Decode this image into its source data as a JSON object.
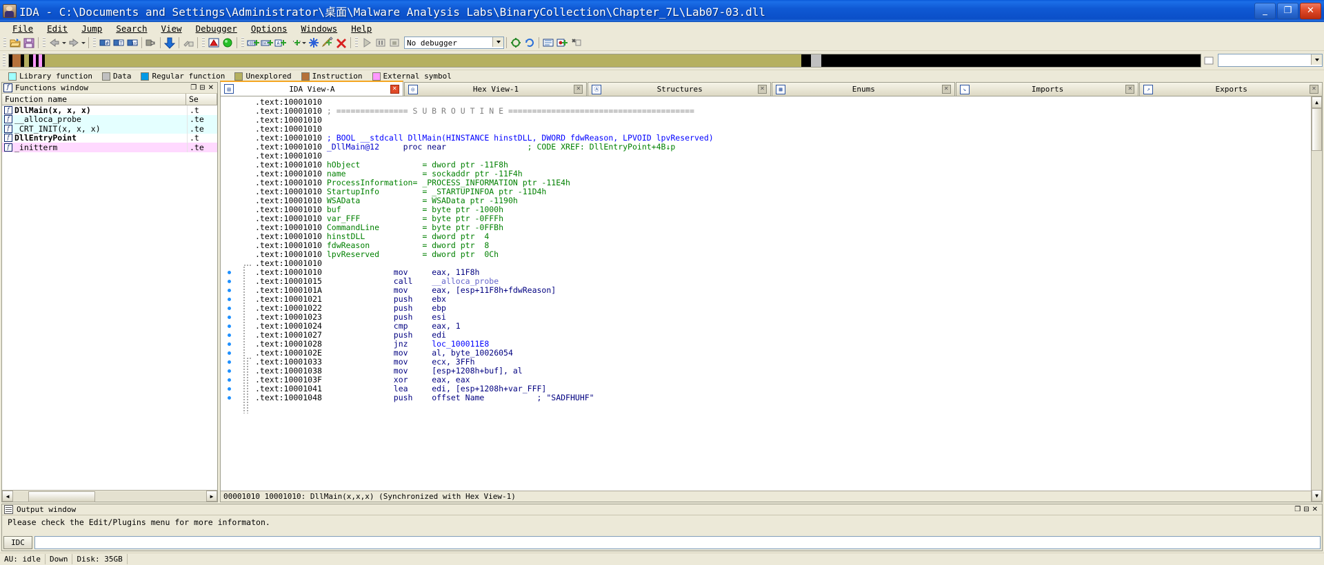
{
  "window": {
    "title": "IDA - C:\\Documents and Settings\\Administrator\\桌面\\Malware Analysis Labs\\BinaryCollection\\Chapter_7L\\Lab07-03.dll",
    "minimize_label": "—",
    "maximize_label": "❐",
    "close_label": "✕"
  },
  "menu": [
    {
      "label": "File"
    },
    {
      "label": "Edit"
    },
    {
      "label": "Jump"
    },
    {
      "label": "Search"
    },
    {
      "label": "View"
    },
    {
      "label": "Debugger"
    },
    {
      "label": "Options"
    },
    {
      "label": "Windows"
    },
    {
      "label": "Help"
    }
  ],
  "toolbar": {
    "debugger_value": "No debugger",
    "icons": [
      "open-file-icon",
      "save-icon",
      "back-arrow-icon",
      "forward-arrow-icon",
      "search-hex-icon",
      "search-text-icon",
      "search-binary-icon",
      "jump-icon",
      "down-arrow-icon",
      "unlock-icon",
      "warning-icon",
      "green-circle-icon",
      "make-code-icon",
      "make-data-icon",
      "make-ascii-icon",
      "make-struct-icon",
      "make-array-icon",
      "edit-function-icon",
      "delete-icon",
      "run-icon",
      "pause-icon",
      "stop-icon"
    ]
  },
  "navbar": {
    "segments": [
      {
        "name": "unexplored-left",
        "color": "#b5b060",
        "left_pct": 0.5,
        "width_pct": 0.6
      },
      {
        "name": "instruction-strip",
        "color": "#b5713a",
        "left_pct": 1.2,
        "width_pct": 0.35
      },
      {
        "name": "external-symbol",
        "color": "#ff99ff",
        "left_pct": 2.1,
        "width_pct": 0.25
      },
      {
        "name": "external-symbol-2",
        "color": "#ff99ff",
        "left_pct": 2.6,
        "width_pct": 0.2
      },
      {
        "name": "unexplored-main",
        "color": "#b5b060",
        "left_pct": 3.1,
        "width_pct": 63.5
      },
      {
        "name": "data-grey",
        "color": "#c0c0c0",
        "left_pct": 67.6,
        "width_pct": 0.9
      }
    ],
    "combo_value": ""
  },
  "legend": [
    {
      "label": "Library function",
      "color": "#9fffff"
    },
    {
      "label": "Data",
      "color": "#c0c0c0"
    },
    {
      "label": "Regular function",
      "color": "#0099e6"
    },
    {
      "label": "Unexplored",
      "color": "#b5b060"
    },
    {
      "label": "Instruction",
      "color": "#b5713a"
    },
    {
      "label": "External symbol",
      "color": "#ff99ff"
    }
  ],
  "functions_window": {
    "title": "Functions window",
    "icon": "function-f-icon",
    "buttons": [
      "maximize-icon",
      "restore-icon",
      "close-icon"
    ],
    "columns": [
      "Function name",
      "Se"
    ],
    "rows": [
      {
        "name": "DllMain(x, x, x)",
        "segment": ".t",
        "bg": "#ffffff",
        "bold": true
      },
      {
        "name": "__alloca_probe",
        "segment": ".te",
        "bg": "#e4ffff",
        "bold": false
      },
      {
        "name": "_CRT_INIT(x, x, x)",
        "segment": ".te",
        "bg": "#e4ffff",
        "bold": false
      },
      {
        "name": "DllEntryPoint",
        "segment": ".t",
        "bg": "#ffffff",
        "bold": true
      },
      {
        "name": "_initterm",
        "segment": ".te",
        "bg": "#ffd9ff",
        "bold": false
      }
    ]
  },
  "tabs": [
    {
      "label": "IDA View-A",
      "icon": "disasm-view-icon",
      "active": true
    },
    {
      "label": "Hex View-1",
      "icon": "hex-view-icon",
      "active": false
    },
    {
      "label": "Structures",
      "icon": "structures-icon",
      "active": false
    },
    {
      "label": "Enums",
      "icon": "enums-icon",
      "active": false
    },
    {
      "label": "Imports",
      "icon": "imports-icon",
      "active": false
    },
    {
      "label": "Exports",
      "icon": "exports-icon",
      "active": false
    }
  ],
  "disassembly": {
    "lines": [
      {
        "addr": ".text:10001010",
        "text": "",
        "kind": "plain",
        "bp": false
      },
      {
        "addr": ".text:10001010",
        "text": "; =============== S U B R O U T I N E =======================================",
        "kind": "comment",
        "bp": false
      },
      {
        "addr": ".text:10001010",
        "text": "",
        "kind": "plain",
        "bp": false
      },
      {
        "addr": ".text:10001010",
        "text": "",
        "kind": "plain",
        "bp": false
      },
      {
        "addr": ".text:10001010",
        "text": "; BOOL __stdcall DllMain(HINSTANCE hinstDLL, DWORD fdwReason, LPVOID lpvReserved)",
        "kind": "decl",
        "bp": false
      },
      {
        "addr": ".text:10001010",
        "name": "_DllMain@12",
        "mnemonic": "proc near",
        "xref": "; CODE XREF: DllEntryPoint+4B↓p",
        "kind": "proc",
        "bp": false
      },
      {
        "addr": ".text:10001010",
        "text": "",
        "kind": "plain",
        "bp": false
      },
      {
        "addr": ".text:10001010",
        "var": "hObject",
        "def": "= dword ptr -11F8h",
        "kind": "var",
        "bp": false
      },
      {
        "addr": ".text:10001010",
        "var": "name",
        "def": "= sockaddr ptr -11F4h",
        "kind": "var",
        "bp": false
      },
      {
        "addr": ".text:10001010",
        "var": "ProcessInformation=",
        "def": "_PROCESS_INFORMATION ptr -11E4h",
        "kind": "var2",
        "bp": false
      },
      {
        "addr": ".text:10001010",
        "var": "StartupInfo",
        "def": "= _STARTUPINFOA ptr -11D4h",
        "kind": "var",
        "bp": false
      },
      {
        "addr": ".text:10001010",
        "var": "WSAData",
        "def": "= WSAData ptr -1190h",
        "kind": "var",
        "bp": false
      },
      {
        "addr": ".text:10001010",
        "var": "buf",
        "def": "= byte ptr -1000h",
        "kind": "var",
        "bp": false
      },
      {
        "addr": ".text:10001010",
        "var": "var_FFF",
        "def": "= byte ptr -0FFFh",
        "kind": "var",
        "bp": false
      },
      {
        "addr": ".text:10001010",
        "var": "CommandLine",
        "def": "= byte ptr -0FFBh",
        "kind": "var",
        "bp": false
      },
      {
        "addr": ".text:10001010",
        "var": "hinstDLL",
        "def": "= dword ptr  4",
        "kind": "var",
        "bp": false
      },
      {
        "addr": ".text:10001010",
        "var": "fdwReason",
        "def": "= dword ptr  8",
        "kind": "var",
        "bp": false
      },
      {
        "addr": ".text:10001010",
        "var": "lpvReserved",
        "def": "= dword ptr  0Ch",
        "kind": "var",
        "bp": false
      },
      {
        "addr": ".text:10001010",
        "text": "",
        "kind": "plain",
        "bp": false
      },
      {
        "addr": ".text:10001010",
        "mnemonic": "mov",
        "operands": "eax, 11F8h",
        "kind": "insn",
        "bp": true
      },
      {
        "addr": ".text:10001015",
        "mnemonic": "call",
        "operands": "__alloca_probe",
        "kind": "call",
        "bp": true
      },
      {
        "addr": ".text:1000101A",
        "mnemonic": "mov",
        "operands": "eax, [esp+11F8h+fdwReason]",
        "kind": "insn",
        "bp": true
      },
      {
        "addr": ".text:10001021",
        "mnemonic": "push",
        "operands": "ebx",
        "kind": "insn",
        "bp": true
      },
      {
        "addr": ".text:10001022",
        "mnemonic": "push",
        "operands": "ebp",
        "kind": "insn",
        "bp": true
      },
      {
        "addr": ".text:10001023",
        "mnemonic": "push",
        "operands": "esi",
        "kind": "insn",
        "bp": true
      },
      {
        "addr": ".text:10001024",
        "mnemonic": "cmp",
        "operands": "eax, 1",
        "kind": "insn",
        "bp": true
      },
      {
        "addr": ".text:10001027",
        "mnemonic": "push",
        "operands": "edi",
        "kind": "insn",
        "bp": true
      },
      {
        "addr": ".text:10001028",
        "mnemonic": "jnz",
        "operands": "loc_100011E8",
        "kind": "jump",
        "bp": true
      },
      {
        "addr": ".text:1000102E",
        "mnemonic": "mov",
        "operands": "al, byte_10026054",
        "kind": "insn",
        "bp": true
      },
      {
        "addr": ".text:10001033",
        "mnemonic": "mov",
        "operands": "ecx, 3FFh",
        "kind": "insn",
        "bp": true
      },
      {
        "addr": ".text:10001038",
        "mnemonic": "mov",
        "operands": "[esp+1208h+buf], al",
        "kind": "insn",
        "bp": true
      },
      {
        "addr": ".text:1000103F",
        "mnemonic": "xor",
        "operands": "eax, eax",
        "kind": "insn",
        "bp": true
      },
      {
        "addr": ".text:10001041",
        "mnemonic": "lea",
        "operands": "edi, [esp+1208h+var_FFF]",
        "kind": "insn",
        "bp": true
      },
      {
        "addr": ".text:10001048",
        "mnemonic": "push",
        "operands": "offset Name",
        "comment": "; \"SADFHUHF\"",
        "kind": "insn_cmt",
        "bp": true
      }
    ],
    "status": "00001010 10001010: DllMain(x,x,x) (Synchronized with Hex View-1)"
  },
  "output_window": {
    "title": "Output window",
    "buttons": [
      "maximize-icon",
      "restore-icon",
      "close-icon"
    ],
    "message": "Please check the Edit/Plugins menu for more informaton.",
    "command_button": "IDC",
    "command_value": ""
  },
  "status_bar": [
    {
      "label": "AU: idle"
    },
    {
      "label": "Down"
    },
    {
      "label": "Disk: 35GB"
    }
  ],
  "colors": {
    "title_blue": "#0f59d4",
    "chrome": "#ece9d8",
    "comment_grey": "#808080",
    "decl_blue": "#0000ff",
    "var_green": "#008000",
    "mnemonic_navy": "#000080",
    "unexplored": "#b5b060"
  }
}
